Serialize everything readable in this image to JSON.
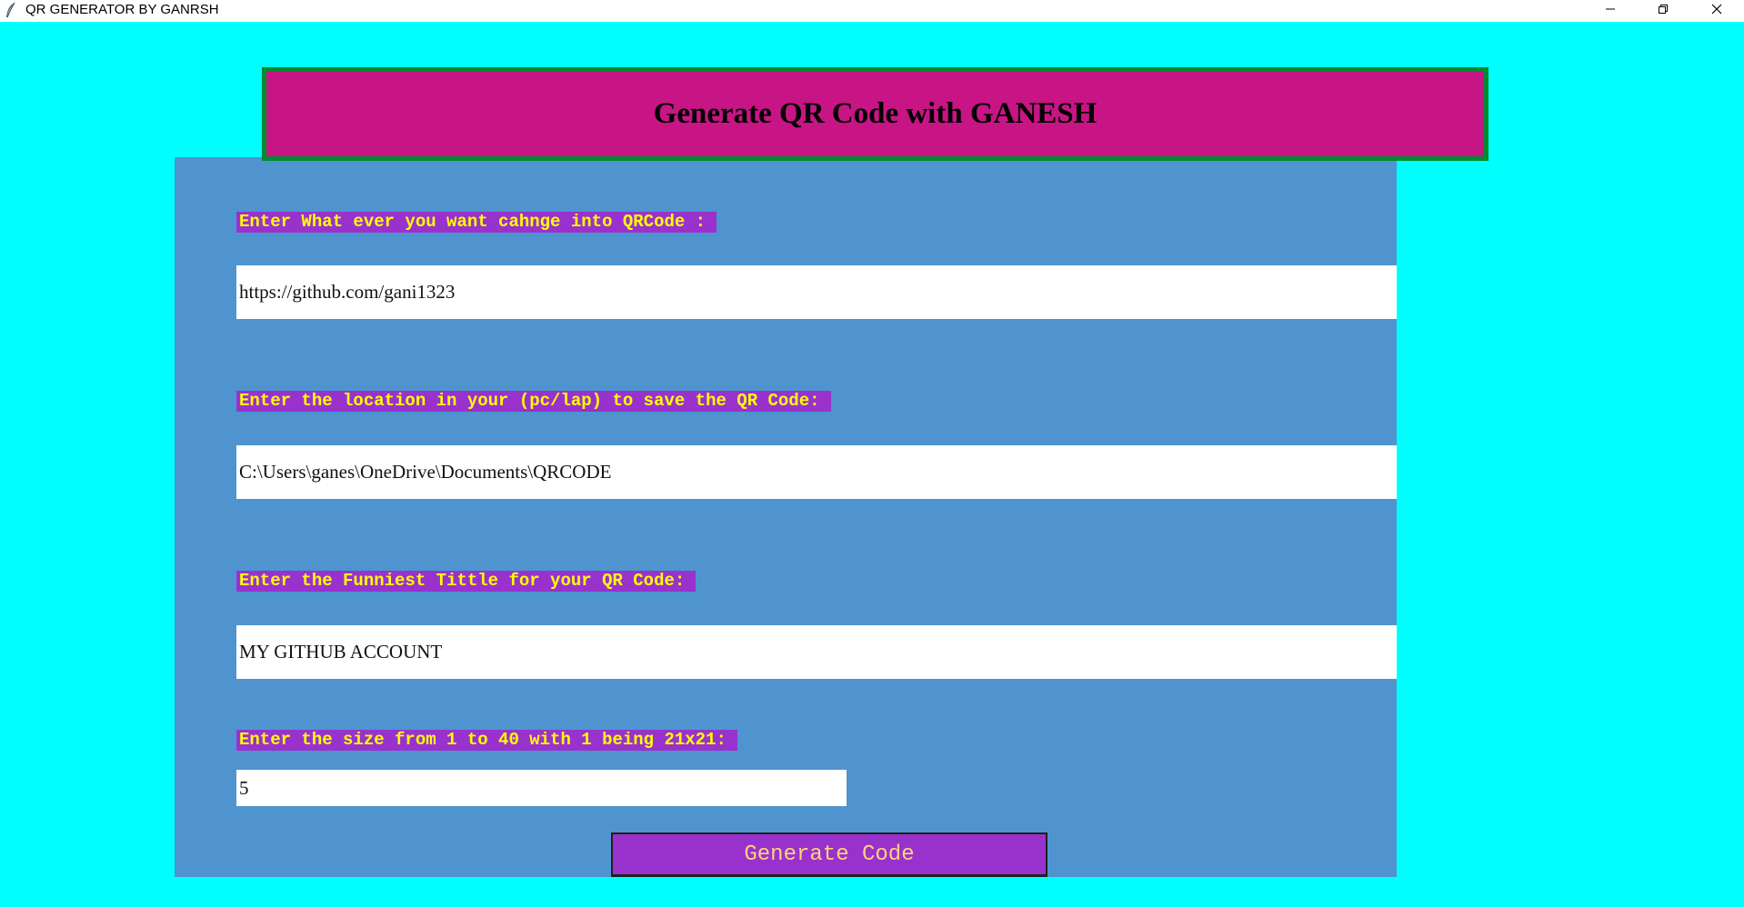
{
  "window": {
    "title": "QR GENERATOR BY GANRSH",
    "icon": "feather-icon",
    "controls": [
      "minimize-icon",
      "restore-icon",
      "close-icon"
    ]
  },
  "banner": {
    "title": "Generate QR Code with GANESH"
  },
  "form": {
    "content_label": "Enter What ever you want cahnge into QRCode :",
    "content_value": "https://github.com/gani1323",
    "location_label": "Enter the location in your (pc/lap) to save the QR Code:",
    "location_value": "C:\\Users\\ganes\\OneDrive\\Documents\\QRCODE",
    "title_label": "Enter the Funniest Tittle for your QR Code:",
    "title_value": "MY GITHUB ACCOUNT",
    "size_label": "Enter the size from 1 to 40 with 1 being 21x21:",
    "size_value": "5",
    "generate_label": "Generate Code"
  },
  "colors": {
    "window_background": "#00ffff",
    "panel_background": "#4f94cf",
    "banner_background": "#c71585",
    "banner_border": "#008b2f",
    "label_background": "#9932cc",
    "label_text": "#ffff00",
    "button_background": "#9932cc",
    "button_text": "#ffd27a"
  }
}
